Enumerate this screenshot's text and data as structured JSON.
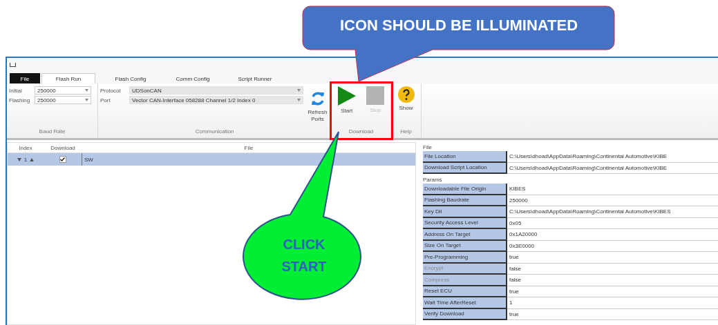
{
  "callouts": [
    {
      "kind": "rect-bubble",
      "text": "ICON SHOULD BE ILLUMINATED"
    },
    {
      "kind": "oval-bubble",
      "text": "CLICK START"
    }
  ],
  "tabs": [
    {
      "label": "File",
      "kind": "menu",
      "selected": false
    },
    {
      "label": "Flash Run",
      "kind": "tab",
      "selected": true
    },
    {
      "label": "Flash Config",
      "kind": "tab",
      "selected": false
    },
    {
      "label": "Comm Config",
      "kind": "tab",
      "selected": false
    },
    {
      "label": "Script Runner",
      "kind": "tab",
      "selected": false
    }
  ],
  "ribbon": {
    "groups": [
      {
        "label": "Baud Rate",
        "kind": "baud",
        "fields": [
          {
            "label": "Initial",
            "value": "250000"
          },
          {
            "label": "Flashing",
            "value": "250000"
          }
        ]
      },
      {
        "label": "Communication",
        "kind": "comm",
        "fields": [
          {
            "label": "Protocol",
            "value": "UDSonCAN"
          },
          {
            "label": "Port",
            "value": "Vector CAN-Interface 058288 Channel 1/2 Index 0"
          }
        ],
        "buttons": [
          {
            "label": "Refresh Ports",
            "kind": "refresh",
            "disabled": false
          }
        ]
      },
      {
        "label": "Download",
        "kind": "buttons",
        "highlighted": true,
        "buttons": [
          {
            "label": "Start",
            "kind": "play",
            "disabled": false
          },
          {
            "label": "Stop",
            "kind": "stop",
            "disabled": true
          }
        ]
      },
      {
        "label": "Help",
        "kind": "buttons",
        "buttons": [
          {
            "label": "Show",
            "kind": "help",
            "disabled": false
          }
        ]
      }
    ]
  },
  "table": {
    "columns": [
      "Index",
      "Download",
      "File"
    ],
    "rows": [
      {
        "index": "1",
        "download": true,
        "file": "SW",
        "selected": true
      }
    ]
  },
  "properties": {
    "sections": [
      {
        "title": "File",
        "rows": [
          {
            "label": "File Location",
            "value": "C:\\Users\\dhoad\\AppData\\Roaming\\Continental Automotive\\KIBE",
            "disabled": false
          },
          {
            "label": "Download Script Location",
            "value": "C:\\Users\\dhoad\\AppData\\Roaming\\Continental Automotive\\KIBE",
            "disabled": false
          }
        ]
      },
      {
        "title": "Params",
        "rows": [
          {
            "label": "Downloadable File Origin",
            "value": "KIBES",
            "disabled": false
          },
          {
            "label": "Flashing Baudrate",
            "value": "250000",
            "disabled": false
          },
          {
            "label": "Key Dll",
            "value": "C:\\Users\\dhoad\\AppData\\Roaming\\Continental Automotive\\KIBES",
            "disabled": false
          },
          {
            "label": "Security Access Level",
            "value": "0x05",
            "disabled": false
          },
          {
            "label": "Address On Target",
            "value": "0x1A20000",
            "disabled": false
          },
          {
            "label": "Size On Target",
            "value": "0x3E0000",
            "disabled": false
          },
          {
            "label": "Pre-Programming",
            "value": "true",
            "disabled": false
          },
          {
            "label": "Encrypt",
            "value": "false",
            "disabled": true
          },
          {
            "label": "Compress",
            "value": "false",
            "disabled": true
          },
          {
            "label": "Reset ECU",
            "value": "true",
            "disabled": false
          },
          {
            "label": "Wait Time AfterReset",
            "value": "1",
            "disabled": false
          },
          {
            "label": "Verify Download",
            "value": "true",
            "disabled": false
          }
        ]
      }
    ]
  }
}
